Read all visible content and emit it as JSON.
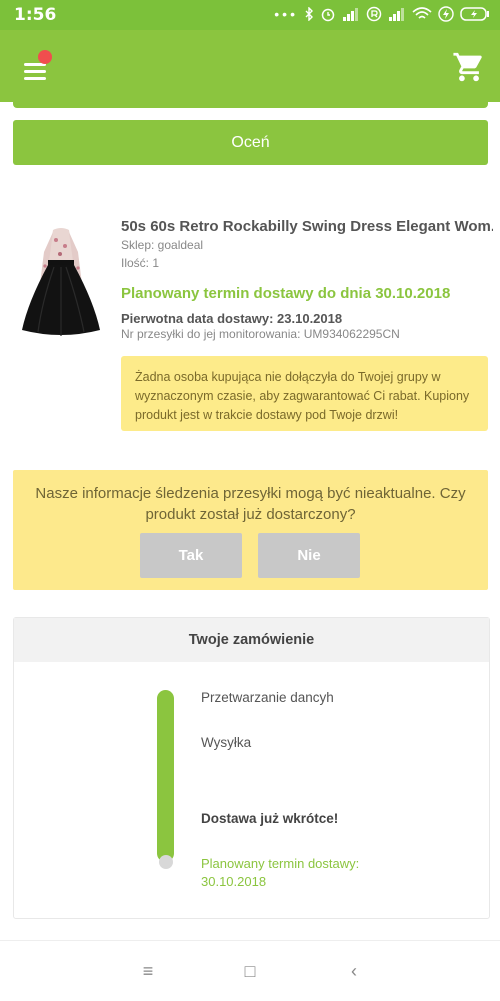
{
  "status_bar": {
    "time": "1:56",
    "icons": [
      "dots-icon",
      "bluetooth-icon",
      "alarm-icon",
      "signal-icon",
      "registered-icon",
      "signal-icon-2",
      "wifi-icon",
      "flash-icon",
      "battery-icon"
    ]
  },
  "app_bar": {
    "menu_icon": "hamburger-menu-icon",
    "notification_dot_color": "#f04e4e",
    "cart_icon": "shopping-cart-icon"
  },
  "rate": {
    "label": "Oceń"
  },
  "product": {
    "title": "50s 60s Retro Rockabilly Swing Dress Elegant Wom...",
    "shop": "Sklep: goaldeal",
    "quantity": "Ilość: 1",
    "planned_delivery": "Planowany termin dostawy do dnia 30.10.2018",
    "original_date": "Pierwotna data dostawy: 23.10.2018",
    "tracking": "Nr przesyłki do jej monitorowania: UM934062295CN",
    "info": "Żadna osoba kupująca nie dołączyła do Twojej grupy w wyznaczonym czasie, aby zagwarantować Ci rabat. Kupiony produkt jest w trakcie dostawy pod Twoje drzwi!"
  },
  "question": {
    "text": "Nasze informacje śledzenia przesyłki mogą być nieaktualne. Czy produkt został już dostarczony?",
    "yes": "Tak",
    "no": "Nie"
  },
  "order": {
    "title": "Twoje zamówienie",
    "steps": [
      {
        "label": "Przetwarzanie dancyh"
      },
      {
        "label": "Wysyłka"
      },
      {
        "label": "Dostawa już wkrótce!"
      },
      {
        "label": "Planowany termin dostawy: 30.10.2018"
      }
    ]
  },
  "nav": {
    "menu_icon": "≡",
    "home_icon": "□",
    "back_icon": "‹"
  },
  "colors": {
    "brand_green": "#8bc53f",
    "status_green": "#7cc13a",
    "info_yellow": "#fdeb8a",
    "button_grey": "#c8c8c8"
  }
}
